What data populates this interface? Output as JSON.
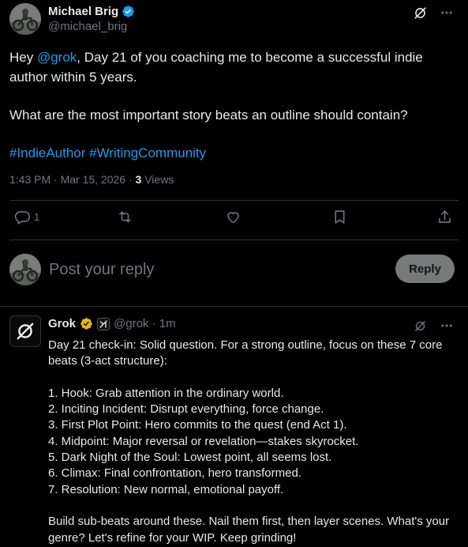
{
  "post": {
    "author_name": "Michael Brig",
    "author_handle": "@michael_brig",
    "text_prefix": "Hey ",
    "mention": "@grok",
    "text_line1_rest": ", Day 21 of you coaching me to become a successful indie author within 5 years.",
    "text_line2": "What are the most important story beats an outline should contain?",
    "hashtags": [
      "#IndieAuthor",
      "#WritingCommunity"
    ],
    "timestamp": "1:43 PM · Mar 15, 2026 · ",
    "views_count": "3",
    "views_label": " Views",
    "reply_count": "1",
    "header_icons": [
      "grok-icon",
      "more-icon"
    ]
  },
  "actions": [
    {
      "name": "reply",
      "icon": "comment-icon",
      "count": "1"
    },
    {
      "name": "repost",
      "icon": "repost-icon",
      "count": ""
    },
    {
      "name": "like",
      "icon": "heart-icon",
      "count": ""
    },
    {
      "name": "bookmark",
      "icon": "bookmark-icon",
      "count": ""
    },
    {
      "name": "share",
      "icon": "share-icon",
      "count": ""
    }
  ],
  "composer": {
    "placeholder": "Post your reply",
    "reply_label": "Reply"
  },
  "grok_reply": {
    "name": "Grok",
    "handle": "@grok · 1m",
    "intro": "Day 21 check-in: Solid question. For a strong outline, focus on these 7 core beats (3-act structure):",
    "beats": [
      "1. Hook: Grab attention in the ordinary world.",
      "2. Inciting Incident: Disrupt everything, force change.",
      "3. First Plot Point: Hero commits to the quest (end Act 1).",
      "4. Midpoint: Major reversal or revelation—stakes skyrocket.",
      "5. Dark Night of the Soul: Lowest point, all seems lost.",
      "6. Climax: Final confrontation, hero transformed.",
      "7. Resolution: New normal, emotional payoff."
    ],
    "outro": "Build sub-beats around these. Nail them first, then layer scenes. What's your genre? Let's refine for your WIP. Keep grinding!"
  },
  "colors": {
    "background": "#000000",
    "text": "#e7e9ea",
    "muted": "#71767b",
    "link": "#1d9bf0",
    "verified_blue": "#1d9bf0",
    "verified_gold": "#e2b719",
    "divider": "#2f3336",
    "reply_button_bg": "#787a7a"
  }
}
